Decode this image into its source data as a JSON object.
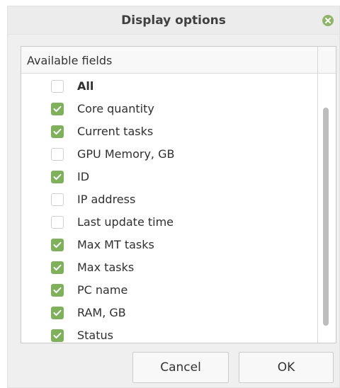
{
  "dialog": {
    "title": "Display options",
    "close_icon": "close-icon"
  },
  "panel": {
    "header": "Available fields",
    "items": [
      {
        "label": "All",
        "checked": false,
        "bold": true
      },
      {
        "label": "Core quantity",
        "checked": true
      },
      {
        "label": "Current tasks",
        "checked": true
      },
      {
        "label": "GPU Memory, GB",
        "checked": false
      },
      {
        "label": "ID",
        "checked": true
      },
      {
        "label": "IP address",
        "checked": false
      },
      {
        "label": "Last update time",
        "checked": false
      },
      {
        "label": "Max MT tasks",
        "checked": true
      },
      {
        "label": "Max tasks",
        "checked": true
      },
      {
        "label": "PC name",
        "checked": true
      },
      {
        "label": "RAM, GB",
        "checked": true
      },
      {
        "label": "Status",
        "checked": true
      }
    ]
  },
  "buttons": {
    "cancel_label": "Cancel",
    "ok_label": "OK"
  },
  "colors": {
    "checkbox_checked": "#7fb05c",
    "close_icon_bg": "#8fb56a"
  }
}
